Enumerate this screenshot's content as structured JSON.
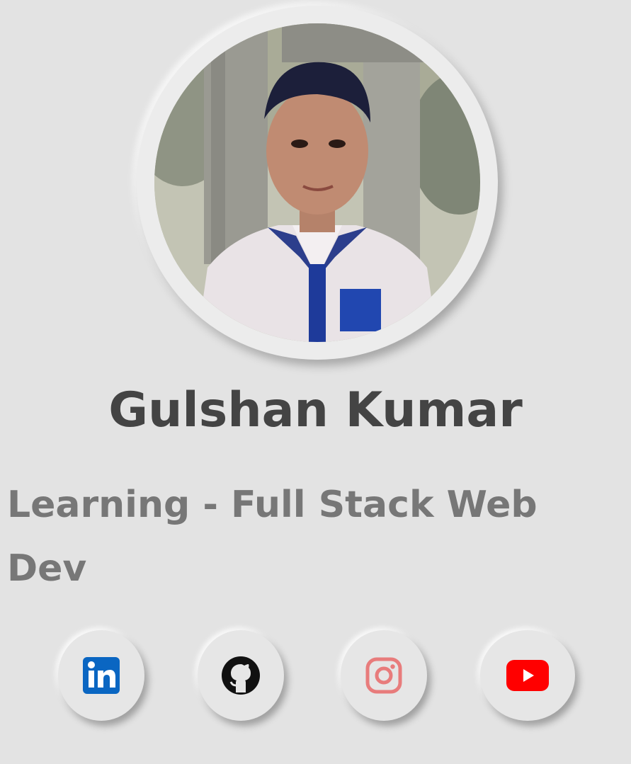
{
  "profile": {
    "name": "Gulshan Kumar",
    "tagline": "Learning - Full Stack Web Dev"
  },
  "socials": [
    {
      "name": "linkedin",
      "icon": "linkedin-icon",
      "color": "#0a66c2"
    },
    {
      "name": "github",
      "icon": "github-icon",
      "color": "#111111"
    },
    {
      "name": "instagram",
      "icon": "instagram-icon",
      "color": "#e87c7c"
    },
    {
      "name": "youtube",
      "icon": "youtube-icon",
      "color": "#ff0000"
    }
  ],
  "colors": {
    "background": "#e3e3e3",
    "name_text": "#444444",
    "tagline_text": "#777777"
  }
}
